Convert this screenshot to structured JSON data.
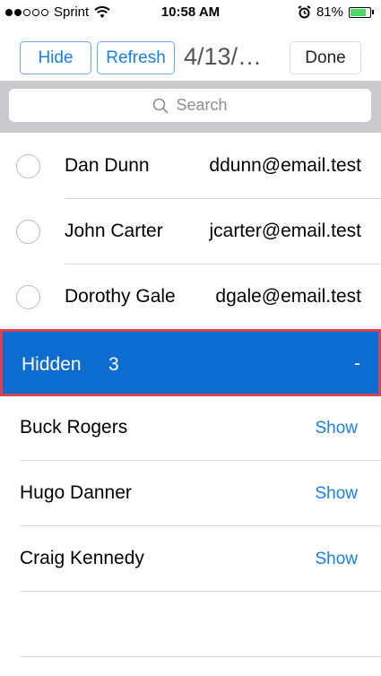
{
  "status_bar": {
    "carrier": "Sprint",
    "time": "10:58 AM",
    "battery": "81%",
    "battery_level": 0.81,
    "signal_bars": 2,
    "icons": [
      "wifi-icon",
      "alarm-icon",
      "battery-icon"
    ]
  },
  "toolbar": {
    "hide_label": "Hide",
    "refresh_label": "Refresh",
    "title": "4/13/…",
    "done_label": "Done"
  },
  "search": {
    "placeholder": "Search"
  },
  "contacts": [
    {
      "name": "Dan Dunn",
      "email": "ddunn@email.test"
    },
    {
      "name": "John Carter",
      "email": "jcarter@email.test"
    },
    {
      "name": "Dorothy Gale",
      "email": "dgale@email.test"
    }
  ],
  "hidden_section": {
    "label": "Hidden",
    "count": "3",
    "toggle": "-"
  },
  "hidden_contacts": [
    {
      "name": "Buck Rogers",
      "action": "Show"
    },
    {
      "name": "Hugo Danner",
      "action": "Show"
    },
    {
      "name": "Craig Kennedy",
      "action": "Show"
    }
  ],
  "colors": {
    "accent": "#1a7fe8",
    "header_bg": "#0c6cd0",
    "header_border": "#d9434f",
    "battery_fill": "#4cd964"
  }
}
